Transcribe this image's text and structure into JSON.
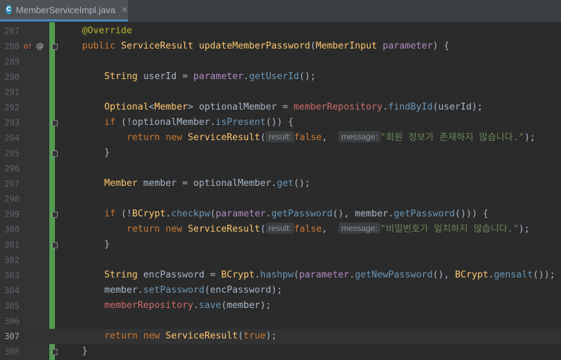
{
  "tab": {
    "icon": "C",
    "label": "MemberServiceImpl.java",
    "close": "✕"
  },
  "gutter_icons": {
    "override": "o!",
    "at": "@"
  },
  "lines": [
    {
      "n": "287"
    },
    {
      "n": "288"
    },
    {
      "n": "289"
    },
    {
      "n": "290"
    },
    {
      "n": "291"
    },
    {
      "n": "292"
    },
    {
      "n": "293"
    },
    {
      "n": "294"
    },
    {
      "n": "295"
    },
    {
      "n": "296"
    },
    {
      "n": "297"
    },
    {
      "n": "298"
    },
    {
      "n": "299"
    },
    {
      "n": "300"
    },
    {
      "n": "301"
    },
    {
      "n": "302"
    },
    {
      "n": "303"
    },
    {
      "n": "304"
    },
    {
      "n": "305"
    },
    {
      "n": "306"
    },
    {
      "n": "307"
    },
    {
      "n": "308"
    }
  ],
  "code": {
    "l287": [
      "@Override"
    ],
    "l288": [
      "public",
      " ",
      "ServiceResult",
      " ",
      "updateMemberPassword",
      "(",
      "MemberInput",
      " ",
      "parameter",
      ") {"
    ],
    "l290": [
      "String",
      " userId = ",
      "parameter",
      ".",
      "getUserId",
      "();"
    ],
    "l292": [
      "Optional",
      "<",
      "Member",
      "> optionalMember = ",
      "memberRepository",
      ".",
      "findById",
      "(userId);"
    ],
    "l293": [
      "if",
      " (!optionalMember.",
      "isPresent",
      "()) {"
    ],
    "l294": [
      "return",
      " ",
      "new",
      " ",
      "ServiceResult",
      "(",
      "result:",
      "false",
      ",  ",
      "message:",
      "\"회원 정보가 존재하지 않습니다.\"",
      ");"
    ],
    "l295": [
      "}"
    ],
    "l297": [
      "Member",
      " member = optionalMember.",
      "get",
      "();"
    ],
    "l299": [
      "if",
      " (!",
      "BCrypt",
      ".",
      "checkpw",
      "(",
      "parameter",
      ".",
      "getPassword",
      "(), member.",
      "getPassword",
      "())) {"
    ],
    "l300": [
      "return",
      " ",
      "new",
      " ",
      "ServiceResult",
      "(",
      "result:",
      "false",
      ",  ",
      "message:",
      "\"비밀번호가 일치하지 않습니다.\"",
      ");"
    ],
    "l301": [
      "}"
    ],
    "l303": [
      "String",
      " encPassword = ",
      "BCrypt",
      ".",
      "hashpw",
      "(",
      "parameter",
      ".",
      "getNewPassword",
      "(), ",
      "BCrypt",
      ".",
      "gensalt",
      "());"
    ],
    "l304": [
      "member.",
      "setPassword",
      "(encPassword);"
    ],
    "l305": [
      "memberRepository",
      ".",
      "save",
      "(member);"
    ],
    "l307": [
      "return",
      " ",
      "new",
      " ",
      "ServiceResult",
      "(",
      "true",
      ");"
    ],
    "l308": [
      "}"
    ]
  }
}
